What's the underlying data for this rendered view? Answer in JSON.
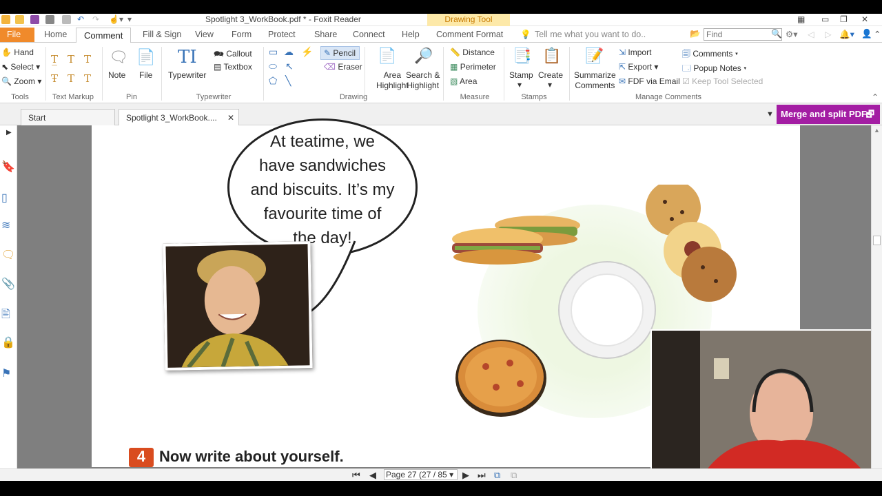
{
  "window": {
    "title": "Spotlight 3_WorkBook.pdf * - Foxit Reader",
    "context_tab": "Drawing Tool"
  },
  "menu_tabs": [
    "File",
    "Home",
    "Comment",
    "Fill & Sign",
    "View",
    "Form",
    "Protect",
    "Share",
    "Connect",
    "Help",
    "Comment Format"
  ],
  "tell_me": "Tell me what you want to do..",
  "find_placeholder": "Find",
  "ribbon": {
    "tools": {
      "hand": "Hand",
      "select": "Select",
      "zoom": "Zoom",
      "group": "Tools"
    },
    "text_markup": {
      "group": "Text Markup"
    },
    "pin": {
      "note": "Note",
      "file": "File",
      "group": "Pin"
    },
    "typewriter": {
      "typewriter": "Typewriter",
      "callout": "Callout",
      "textbox": "Textbox",
      "group": "Typewriter"
    },
    "drawing": {
      "pencil": "Pencil",
      "eraser": "Eraser",
      "group": "Drawing"
    },
    "highlight": {
      "area_1": "Area",
      "area_2": "Highlight",
      "search_1": "Search &",
      "search_2": "Highlight"
    },
    "measure": {
      "distance": "Distance",
      "perimeter": "Perimeter",
      "area": "Area",
      "group": "Measure"
    },
    "stamps": {
      "stamp": "Stamp",
      "create": "Create",
      "group": "Stamps"
    },
    "manage": {
      "summarize_1": "Summarize",
      "summarize_2": "Comments",
      "import": "Import",
      "export": "Export",
      "fdf": "FDF via Email",
      "comments": "Comments",
      "popup": "Popup Notes",
      "keep": "Keep Tool Selected",
      "group": "Manage Comments"
    }
  },
  "doc_tabs": [
    "Start",
    "Spotlight 3_WorkBook...."
  ],
  "merge_button": "Merge and split PDFs",
  "page_content": {
    "bubble_lines": [
      "At teatime, we",
      "have sandwiches",
      "and biscuits. It’s my",
      "favourite time of",
      "the day!"
    ],
    "exercise_number": "4",
    "exercise_title": "Now write about yourself."
  },
  "status": {
    "page_display": "Page 27 (27 / 85"
  },
  "colors": {
    "file_tab": "#f08a2b",
    "merge": "#a31da3",
    "context_tab": "#fde9a9",
    "exercise_badge": "#d94c1f"
  }
}
